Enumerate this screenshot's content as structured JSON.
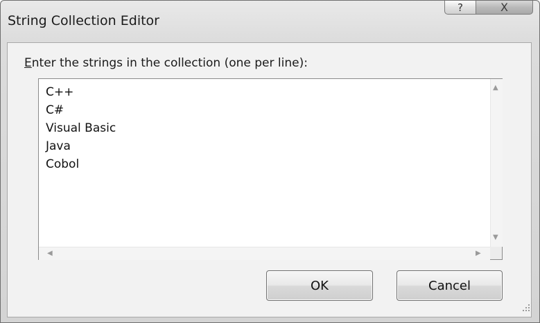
{
  "window": {
    "title": "String Collection Editor",
    "help_glyph": "?",
    "close_glyph": "X"
  },
  "prompt": {
    "accelerator": "E",
    "rest": "nter the strings in the collection (one per line):"
  },
  "collection": {
    "lines": [
      "C++",
      "C#",
      "Visual Basic",
      "Java",
      "Cobol"
    ]
  },
  "buttons": {
    "ok_label": "OK",
    "cancel_label": "Cancel"
  },
  "icons": {
    "help": "help-icon",
    "close": "close-icon",
    "scroll_up": "scroll-up-arrow-icon",
    "scroll_down": "scroll-down-arrow-icon",
    "scroll_left": "scroll-left-arrow-icon",
    "scroll_right": "scroll-right-arrow-icon",
    "resize_grip": "resize-grip-icon"
  }
}
